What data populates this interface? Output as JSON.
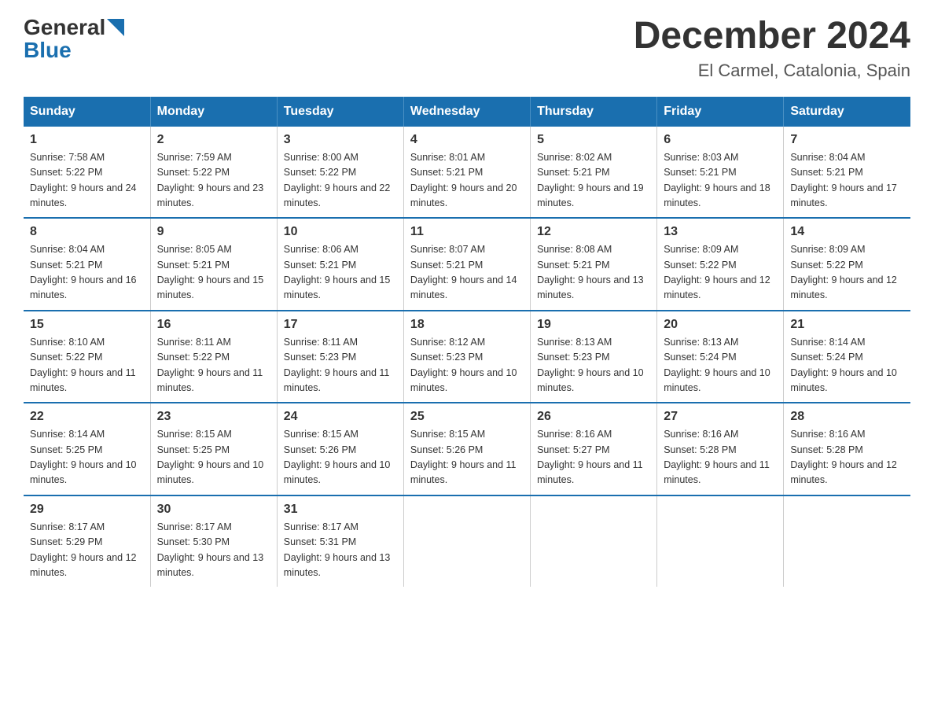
{
  "header": {
    "logo_general": "General",
    "logo_blue": "Blue",
    "title": "December 2024",
    "subtitle": "El Carmel, Catalonia, Spain"
  },
  "weekdays": [
    "Sunday",
    "Monday",
    "Tuesday",
    "Wednesday",
    "Thursday",
    "Friday",
    "Saturday"
  ],
  "weeks": [
    [
      {
        "day": "1",
        "sunrise": "Sunrise: 7:58 AM",
        "sunset": "Sunset: 5:22 PM",
        "daylight": "Daylight: 9 hours and 24 minutes."
      },
      {
        "day": "2",
        "sunrise": "Sunrise: 7:59 AM",
        "sunset": "Sunset: 5:22 PM",
        "daylight": "Daylight: 9 hours and 23 minutes."
      },
      {
        "day": "3",
        "sunrise": "Sunrise: 8:00 AM",
        "sunset": "Sunset: 5:22 PM",
        "daylight": "Daylight: 9 hours and 22 minutes."
      },
      {
        "day": "4",
        "sunrise": "Sunrise: 8:01 AM",
        "sunset": "Sunset: 5:21 PM",
        "daylight": "Daylight: 9 hours and 20 minutes."
      },
      {
        "day": "5",
        "sunrise": "Sunrise: 8:02 AM",
        "sunset": "Sunset: 5:21 PM",
        "daylight": "Daylight: 9 hours and 19 minutes."
      },
      {
        "day": "6",
        "sunrise": "Sunrise: 8:03 AM",
        "sunset": "Sunset: 5:21 PM",
        "daylight": "Daylight: 9 hours and 18 minutes."
      },
      {
        "day": "7",
        "sunrise": "Sunrise: 8:04 AM",
        "sunset": "Sunset: 5:21 PM",
        "daylight": "Daylight: 9 hours and 17 minutes."
      }
    ],
    [
      {
        "day": "8",
        "sunrise": "Sunrise: 8:04 AM",
        "sunset": "Sunset: 5:21 PM",
        "daylight": "Daylight: 9 hours and 16 minutes."
      },
      {
        "day": "9",
        "sunrise": "Sunrise: 8:05 AM",
        "sunset": "Sunset: 5:21 PM",
        "daylight": "Daylight: 9 hours and 15 minutes."
      },
      {
        "day": "10",
        "sunrise": "Sunrise: 8:06 AM",
        "sunset": "Sunset: 5:21 PM",
        "daylight": "Daylight: 9 hours and 15 minutes."
      },
      {
        "day": "11",
        "sunrise": "Sunrise: 8:07 AM",
        "sunset": "Sunset: 5:21 PM",
        "daylight": "Daylight: 9 hours and 14 minutes."
      },
      {
        "day": "12",
        "sunrise": "Sunrise: 8:08 AM",
        "sunset": "Sunset: 5:21 PM",
        "daylight": "Daylight: 9 hours and 13 minutes."
      },
      {
        "day": "13",
        "sunrise": "Sunrise: 8:09 AM",
        "sunset": "Sunset: 5:22 PM",
        "daylight": "Daylight: 9 hours and 12 minutes."
      },
      {
        "day": "14",
        "sunrise": "Sunrise: 8:09 AM",
        "sunset": "Sunset: 5:22 PM",
        "daylight": "Daylight: 9 hours and 12 minutes."
      }
    ],
    [
      {
        "day": "15",
        "sunrise": "Sunrise: 8:10 AM",
        "sunset": "Sunset: 5:22 PM",
        "daylight": "Daylight: 9 hours and 11 minutes."
      },
      {
        "day": "16",
        "sunrise": "Sunrise: 8:11 AM",
        "sunset": "Sunset: 5:22 PM",
        "daylight": "Daylight: 9 hours and 11 minutes."
      },
      {
        "day": "17",
        "sunrise": "Sunrise: 8:11 AM",
        "sunset": "Sunset: 5:23 PM",
        "daylight": "Daylight: 9 hours and 11 minutes."
      },
      {
        "day": "18",
        "sunrise": "Sunrise: 8:12 AM",
        "sunset": "Sunset: 5:23 PM",
        "daylight": "Daylight: 9 hours and 10 minutes."
      },
      {
        "day": "19",
        "sunrise": "Sunrise: 8:13 AM",
        "sunset": "Sunset: 5:23 PM",
        "daylight": "Daylight: 9 hours and 10 minutes."
      },
      {
        "day": "20",
        "sunrise": "Sunrise: 8:13 AM",
        "sunset": "Sunset: 5:24 PM",
        "daylight": "Daylight: 9 hours and 10 minutes."
      },
      {
        "day": "21",
        "sunrise": "Sunrise: 8:14 AM",
        "sunset": "Sunset: 5:24 PM",
        "daylight": "Daylight: 9 hours and 10 minutes."
      }
    ],
    [
      {
        "day": "22",
        "sunrise": "Sunrise: 8:14 AM",
        "sunset": "Sunset: 5:25 PM",
        "daylight": "Daylight: 9 hours and 10 minutes."
      },
      {
        "day": "23",
        "sunrise": "Sunrise: 8:15 AM",
        "sunset": "Sunset: 5:25 PM",
        "daylight": "Daylight: 9 hours and 10 minutes."
      },
      {
        "day": "24",
        "sunrise": "Sunrise: 8:15 AM",
        "sunset": "Sunset: 5:26 PM",
        "daylight": "Daylight: 9 hours and 10 minutes."
      },
      {
        "day": "25",
        "sunrise": "Sunrise: 8:15 AM",
        "sunset": "Sunset: 5:26 PM",
        "daylight": "Daylight: 9 hours and 11 minutes."
      },
      {
        "day": "26",
        "sunrise": "Sunrise: 8:16 AM",
        "sunset": "Sunset: 5:27 PM",
        "daylight": "Daylight: 9 hours and 11 minutes."
      },
      {
        "day": "27",
        "sunrise": "Sunrise: 8:16 AM",
        "sunset": "Sunset: 5:28 PM",
        "daylight": "Daylight: 9 hours and 11 minutes."
      },
      {
        "day": "28",
        "sunrise": "Sunrise: 8:16 AM",
        "sunset": "Sunset: 5:28 PM",
        "daylight": "Daylight: 9 hours and 12 minutes."
      }
    ],
    [
      {
        "day": "29",
        "sunrise": "Sunrise: 8:17 AM",
        "sunset": "Sunset: 5:29 PM",
        "daylight": "Daylight: 9 hours and 12 minutes."
      },
      {
        "day": "30",
        "sunrise": "Sunrise: 8:17 AM",
        "sunset": "Sunset: 5:30 PM",
        "daylight": "Daylight: 9 hours and 13 minutes."
      },
      {
        "day": "31",
        "sunrise": "Sunrise: 8:17 AM",
        "sunset": "Sunset: 5:31 PM",
        "daylight": "Daylight: 9 hours and 13 minutes."
      },
      null,
      null,
      null,
      null
    ]
  ]
}
